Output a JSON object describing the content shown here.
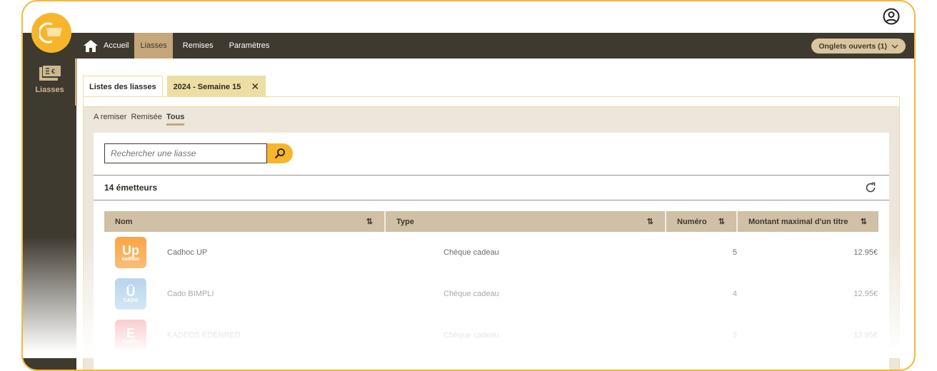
{
  "sidebar": {
    "items": [
      {
        "label": "Liasses",
        "icon": "banknote-euro-icon"
      }
    ]
  },
  "nav": {
    "items": [
      {
        "label": "Accueil",
        "icon": "home-icon"
      },
      {
        "label": "Liasses",
        "active": true
      },
      {
        "label": "Remises"
      },
      {
        "label": "Paramètres"
      }
    ],
    "open_tabs": "Onglets ouverts (1)"
  },
  "tabs": [
    {
      "label": "Listes des liasses"
    },
    {
      "label": "2024 - Semaine 15",
      "closable": true
    }
  ],
  "filters": [
    "A remiser",
    "Remisée",
    "Tous"
  ],
  "filter_selected": "Tous",
  "search": {
    "placeholder": "Rechercher une liasse"
  },
  "count": "14 émetteurs",
  "table": {
    "columns": [
      "Nom",
      "Type",
      "Numéro",
      "Montant maximal d'un titre"
    ],
    "rows": [
      {
        "logo": "Up",
        "logo_sub": "cadhoc",
        "logo_color": "#f9a545",
        "nom": "Cadhoc UP",
        "type": "Chèque cadeau",
        "numero": "5",
        "montant": "12.95€"
      },
      {
        "logo": "Ü",
        "logo_sub": "CADO",
        "logo_color": "#8ebee3",
        "nom": "Cado BIMPLI",
        "type": "Chèque cadeau",
        "numero": "4",
        "montant": "12.95€"
      },
      {
        "logo": "E",
        "logo_sub": "Kadéos",
        "logo_color": "#e94c4c",
        "nom": "KADEOS EDENRED",
        "type": "Chèque cadeau",
        "numero": "3",
        "montant": "12.95€"
      }
    ]
  },
  "colors": {
    "accent": "#f7b52c",
    "dark": "#3f3a30",
    "tan": "#c5a77a"
  }
}
